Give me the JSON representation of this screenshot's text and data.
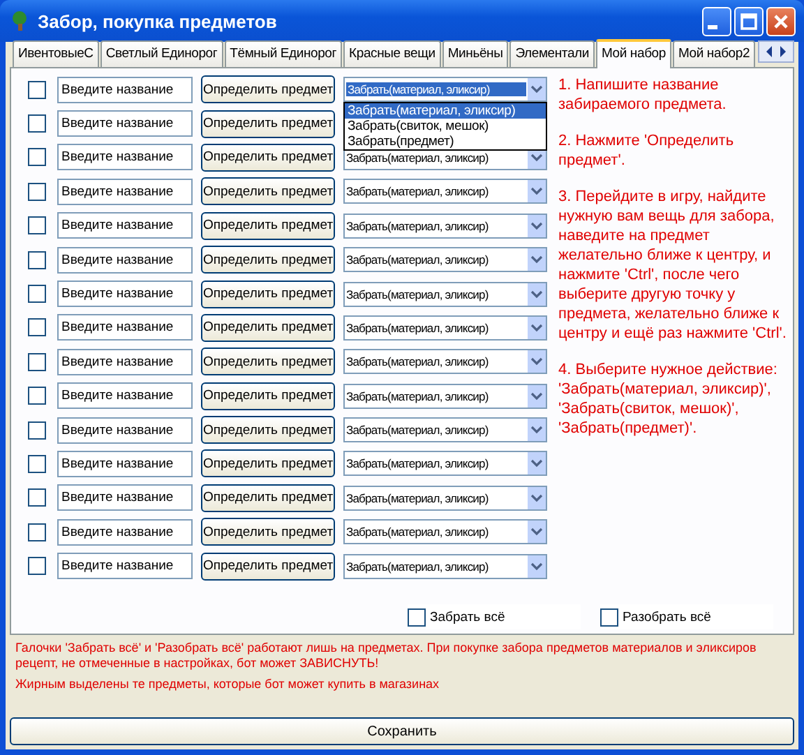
{
  "window": {
    "title": "Забор, покупка предметов"
  },
  "tabs": [
    {
      "label": "ИвентовыеС",
      "selected": false
    },
    {
      "label": "Светлый Единорог",
      "selected": false
    },
    {
      "label": "Тёмный Единорог",
      "selected": false
    },
    {
      "label": "Красные вещи",
      "selected": false
    },
    {
      "label": "Миньёны",
      "selected": false
    },
    {
      "label": "Элементали",
      "selected": false
    },
    {
      "label": "Мой набор",
      "selected": true
    },
    {
      "label": "Мой набор2",
      "selected": false
    }
  ],
  "rows": [
    {
      "checked": false,
      "placeholder": "Введите название",
      "button": "Определить предмет",
      "select": {
        "value": "Забрать(материал, эликсир)",
        "open": true,
        "options": [
          {
            "label": "Забрать(материал, эликсир)",
            "selected": true
          },
          {
            "label": "Забрать(свиток, мешок)",
            "selected": false
          },
          {
            "label": "Забрать(предмет)",
            "selected": false
          }
        ]
      }
    },
    {
      "checked": false,
      "placeholder": "Введите название",
      "button": "Определить предмет"
    },
    {
      "checked": false,
      "placeholder": "Введите название",
      "button": "Определить предмет",
      "select": {
        "value": "Забрать(материал, эликсир)",
        "open": false
      }
    },
    {
      "checked": false,
      "placeholder": "Введите название",
      "button": "Определить предмет",
      "select": {
        "value": "Забрать(материал, эликсир)",
        "open": false
      }
    },
    {
      "checked": false,
      "placeholder": "Введите название",
      "button": "Определить предмет",
      "select": {
        "value": "Забрать(материал, эликсир)",
        "open": false
      }
    },
    {
      "checked": false,
      "placeholder": "Введите название",
      "button": "Определить предмет",
      "select": {
        "value": "Забрать(материал, эликсир)",
        "open": false
      }
    },
    {
      "checked": false,
      "placeholder": "Введите название",
      "button": "Определить предмет",
      "select": {
        "value": "Забрать(материал, эликсир)",
        "open": false
      }
    },
    {
      "checked": false,
      "placeholder": "Введите название",
      "button": "Определить предмет",
      "select": {
        "value": "Забрать(материал, эликсир)",
        "open": false
      }
    },
    {
      "checked": false,
      "placeholder": "Введите название",
      "button": "Определить предмет",
      "select": {
        "value": "Забрать(материал, эликсир)",
        "open": false
      }
    },
    {
      "checked": false,
      "placeholder": "Введите название",
      "button": "Определить предмет",
      "select": {
        "value": "Забрать(материал, эликсир)",
        "open": false
      }
    },
    {
      "checked": false,
      "placeholder": "Введите название",
      "button": "Определить предмет",
      "select": {
        "value": "Забрать(материал, эликсир)",
        "open": false
      }
    },
    {
      "checked": false,
      "placeholder": "Введите название",
      "button": "Определить предмет",
      "select": {
        "value": "Забрать(материал, эликсир)",
        "open": false
      }
    },
    {
      "checked": false,
      "placeholder": "Введите название",
      "button": "Определить предмет",
      "select": {
        "value": "Забрать(материал, эликсир)",
        "open": false
      }
    },
    {
      "checked": false,
      "placeholder": "Введите название",
      "button": "Определить предмет",
      "select": {
        "value": "Забрать(материал, эликсир)",
        "open": false
      }
    },
    {
      "checked": false,
      "placeholder": "Введите название",
      "button": "Определить предмет",
      "select": {
        "value": "Забрать(материал, эликсир)",
        "open": false
      }
    }
  ],
  "instructions": [
    "1. Напишите название забираемого предмета.",
    "2. Нажмите 'Определить предмет'.",
    "3. Перейдите в игру, найдите нужную вам вещь для забора, наведите на предмет желательно ближе к центру, и нажмите 'Ctrl', после чего выберите другую точку у предмета, желательно ближе к центру и ещё раз нажмите 'Ctrl'.",
    "4. Выберите нужное действие: 'Забрать(материал, эликсир)', 'Забрать(свиток, мешок)', 'Забрать(предмет)'."
  ],
  "bulk_checks": [
    {
      "label": "Забрать всё",
      "checked": false
    },
    {
      "label": "Разобрать всё",
      "checked": false
    }
  ],
  "notes": [
    "Галочки 'Забрать всё' и 'Разобрать всё' работают лишь на предметах. При покупке забора предметов материалов и эликсиров рецепт, не отмеченные в настройках, бот может ЗАВИСНУТЬ!",
    "Жирным выделены те предметы, которые бот может купить в магазинах"
  ],
  "save_button": "Сохранить"
}
